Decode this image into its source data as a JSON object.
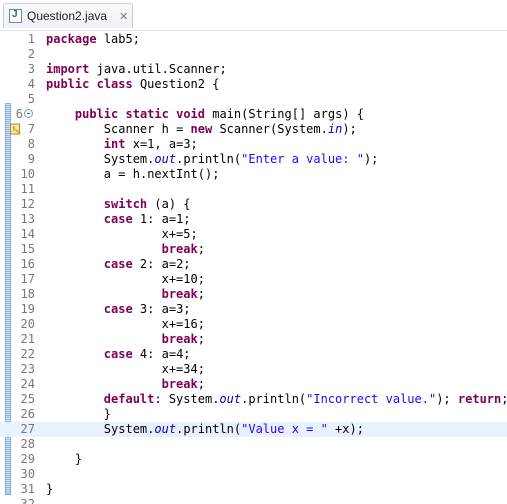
{
  "tab": {
    "title": "Question2.java",
    "close": "✕",
    "icon": "java-file-icon"
  },
  "lines": [
    {
      "n": "1",
      "code": "package lab5;"
    },
    {
      "n": "2",
      "code": ""
    },
    {
      "n": "3",
      "code": "import java.util.Scanner;"
    },
    {
      "n": "4",
      "code": "public class Question2 {"
    },
    {
      "n": "5",
      "code": ""
    },
    {
      "n": "6",
      "code": "    public static void main(String[] args) {"
    },
    {
      "n": "7",
      "code": "        Scanner h = new Scanner(System.in);"
    },
    {
      "n": "8",
      "code": "        int x=1, a=3;"
    },
    {
      "n": "9",
      "code": "        System.out.println(\"Enter a value: \");"
    },
    {
      "n": "10",
      "code": "        a = h.nextInt();"
    },
    {
      "n": "11",
      "code": ""
    },
    {
      "n": "12",
      "code": "        switch (a) {"
    },
    {
      "n": "13",
      "code": "        case 1: a=1;"
    },
    {
      "n": "14",
      "code": "                x+=5;"
    },
    {
      "n": "15",
      "code": "                break;"
    },
    {
      "n": "16",
      "code": "        case 2: a=2;"
    },
    {
      "n": "17",
      "code": "                x+=10;"
    },
    {
      "n": "18",
      "code": "                break;"
    },
    {
      "n": "19",
      "code": "        case 3: a=3;"
    },
    {
      "n": "20",
      "code": "                x+=16;"
    },
    {
      "n": "21",
      "code": "                break;"
    },
    {
      "n": "22",
      "code": "        case 4: a=4;"
    },
    {
      "n": "23",
      "code": "                x+=34;"
    },
    {
      "n": "24",
      "code": "                break;"
    },
    {
      "n": "25",
      "code": "        default: System.out.println(\"Incorrect value.\"); return;"
    },
    {
      "n": "26",
      "code": "        }"
    },
    {
      "n": "27",
      "code": "        System.out.println(\"Value x = \" +x);"
    },
    {
      "n": "28",
      "code": ""
    },
    {
      "n": "29",
      "code": "    }"
    },
    {
      "n": "30",
      "code": ""
    },
    {
      "n": "31",
      "code": "}"
    },
    {
      "n": "32",
      "code": ""
    }
  ],
  "current_line": "27",
  "colors": {
    "keyword": "#7f0055",
    "string": "#2a00ff",
    "static_field": "#0000c0",
    "current_line": "#e8f2fe"
  }
}
